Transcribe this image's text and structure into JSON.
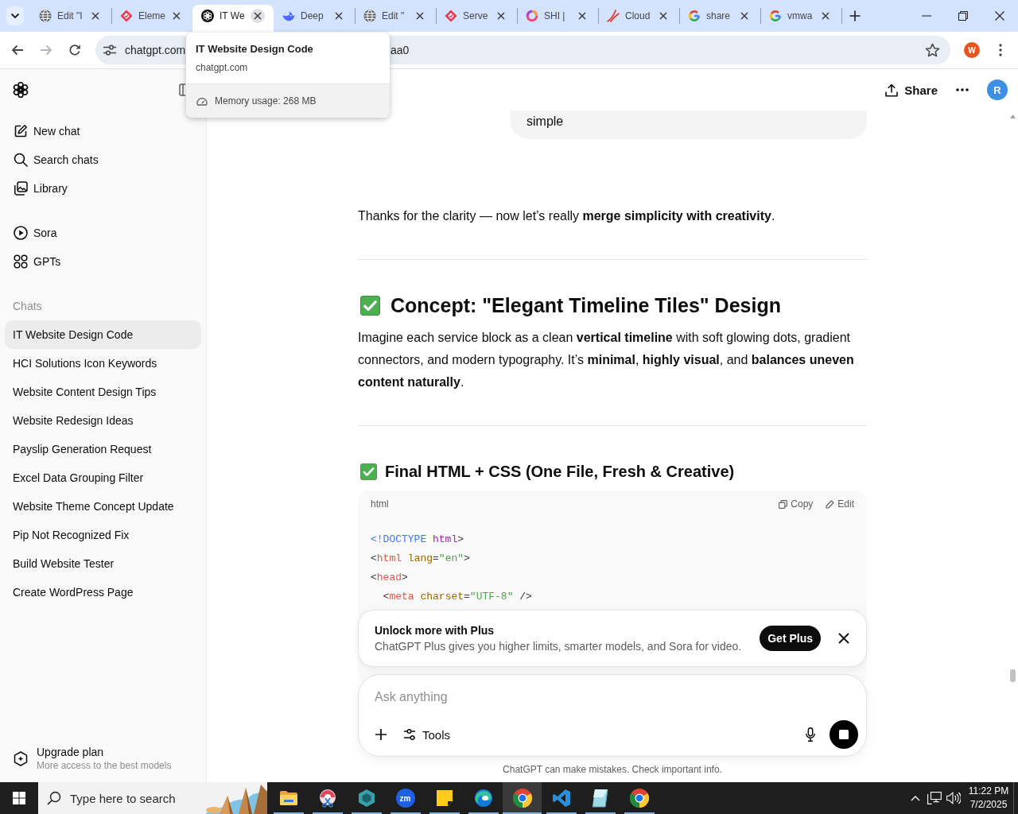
{
  "browser": {
    "tabs": [
      {
        "title": "Edit \"I",
        "kind": "globe",
        "selected": false
      },
      {
        "title": "Eleme",
        "kind": "diamond",
        "selected": false
      },
      {
        "title": "IT We",
        "kind": "knot",
        "selected": true
      },
      {
        "title": "Deep",
        "kind": "whale",
        "selected": false
      },
      {
        "title": "Edit \"",
        "kind": "globe",
        "selected": false
      },
      {
        "title": "Serve",
        "kind": "diamond",
        "selected": false
      },
      {
        "title": "SHI |",
        "kind": "ring",
        "selected": false
      },
      {
        "title": "Cloud",
        "kind": "swoosh",
        "selected": false
      },
      {
        "title": "share",
        "kind": "google",
        "selected": false
      },
      {
        "title": "vmwa",
        "kind": "google",
        "selected": false
      }
    ],
    "address_bar": {
      "url_start": "chatgpt.com",
      "url_end": "aa0"
    },
    "profile": {
      "initial": "W"
    },
    "hover_card": {
      "title": "IT Website Design Code",
      "domain": "chatgpt.com",
      "memory": "Memory usage: 268 MB"
    }
  },
  "sidebar": {
    "nav": [
      {
        "label": "New chat",
        "kind": "new-chat"
      },
      {
        "label": "Search chats",
        "kind": "search"
      },
      {
        "label": "Library",
        "kind": "library"
      }
    ],
    "features": [
      {
        "label": "Sora",
        "kind": "play"
      },
      {
        "label": "GPTs",
        "kind": "grid"
      }
    ],
    "section_label": "Chats",
    "chats": [
      {
        "title": "IT Website Design Code",
        "selected": true
      },
      {
        "title": "HCI Solutions Icon Keywords",
        "selected": false
      },
      {
        "title": "Website Content Design Tips",
        "selected": false
      },
      {
        "title": "Website Redesign Ideas",
        "selected": false
      },
      {
        "title": "Payslip Generation Request",
        "selected": false
      },
      {
        "title": "Excel Data Grouping Filter",
        "selected": false
      },
      {
        "title": "Website Theme Concept Update",
        "selected": false
      },
      {
        "title": "Pip Not Recognized Fix",
        "selected": false
      },
      {
        "title": "Build Website Tester",
        "selected": false
      },
      {
        "title": "Create WordPress Page",
        "selected": false
      }
    ],
    "upgrade": {
      "title": "Upgrade plan",
      "subtitle": "More access to the best models"
    }
  },
  "header": {
    "share_label": "Share",
    "avatar": "R"
  },
  "conversation": {
    "user_message": "simple",
    "assistant": [
      {
        "kind": "paragraph",
        "text": "Thanks for the clarity — now let’s really **merge simplicity with creativity**."
      },
      {
        "kind": "divider"
      },
      {
        "kind": "heading-large",
        "text": "Concept: \"Elegant Timeline Tiles\" Design"
      },
      {
        "kind": "paragraph",
        "text": "Imagine each service block as a clean **vertical timeline** with soft glowing dots, gradient connectors, and modern typography. It’s **minimal**, **highly visual**, and **balances uneven content naturally**."
      },
      {
        "kind": "divider"
      },
      {
        "kind": "heading",
        "text": "Final HTML + CSS (One File, Fresh & Creative)"
      },
      {
        "kind": "code",
        "language": "html",
        "copy": "Copy",
        "edit": "Edit",
        "lines": [
          [
            {
              "kind": "doctype",
              "text": "<!DOCTYPE"
            },
            {
              "kind": "name",
              "text": " html"
            },
            {
              "kind": "punct",
              "text": ">"
            }
          ],
          [
            {
              "kind": "punct",
              "text": "<"
            },
            {
              "kind": "tag",
              "text": "html"
            },
            {
              "kind": "attr",
              "text": " lang"
            },
            {
              "kind": "punct",
              "text": "="
            },
            {
              "kind": "string",
              "text": "\"en\""
            },
            {
              "kind": "punct",
              "text": ">"
            }
          ],
          [
            {
              "kind": "punct",
              "text": "<"
            },
            {
              "kind": "tag",
              "text": "head"
            },
            {
              "kind": "punct",
              "text": ">"
            }
          ],
          [
            {
              "kind": "punct",
              "text": "  <"
            },
            {
              "kind": "tag",
              "text": "meta"
            },
            {
              "kind": "attr",
              "text": " charset"
            },
            {
              "kind": "punct",
              "text": "="
            },
            {
              "kind": "string",
              "text": "\"UTF-8\""
            },
            {
              "kind": "punct",
              "text": " />"
            }
          ]
        ]
      }
    ]
  },
  "upsell": {
    "title": "Unlock more with Plus",
    "text": "ChatGPT Plus gives you higher limits, smarter models, and Sora for video.",
    "button": "Get Plus"
  },
  "composer": {
    "placeholder": "Ask anything",
    "tools": "Tools"
  },
  "disclaimer": "ChatGPT can make mistakes. Check important info.",
  "taskbar": {
    "search": {
      "placeholder": "Type here to search"
    },
    "apps": [
      {
        "kind": "folder",
        "selected": false,
        "running": true
      },
      {
        "kind": "scissors",
        "selected": false,
        "running": true
      },
      {
        "kind": "hexagon",
        "selected": false,
        "running": true
      },
      {
        "kind": "zoom",
        "label": "zm",
        "selected": false,
        "running": true
      },
      {
        "kind": "note",
        "selected": false,
        "running": true
      },
      {
        "kind": "edge",
        "selected": false,
        "running": true
      },
      {
        "kind": "chrome",
        "selected": true,
        "running": true
      },
      {
        "kind": "code",
        "selected": false,
        "running": true
      },
      {
        "kind": "notepad",
        "selected": false,
        "running": true
      },
      {
        "kind": "chrome",
        "selected": false,
        "running": true
      }
    ],
    "clock": {
      "time": "11:22 PM",
      "date": "7/2/2025"
    }
  }
}
